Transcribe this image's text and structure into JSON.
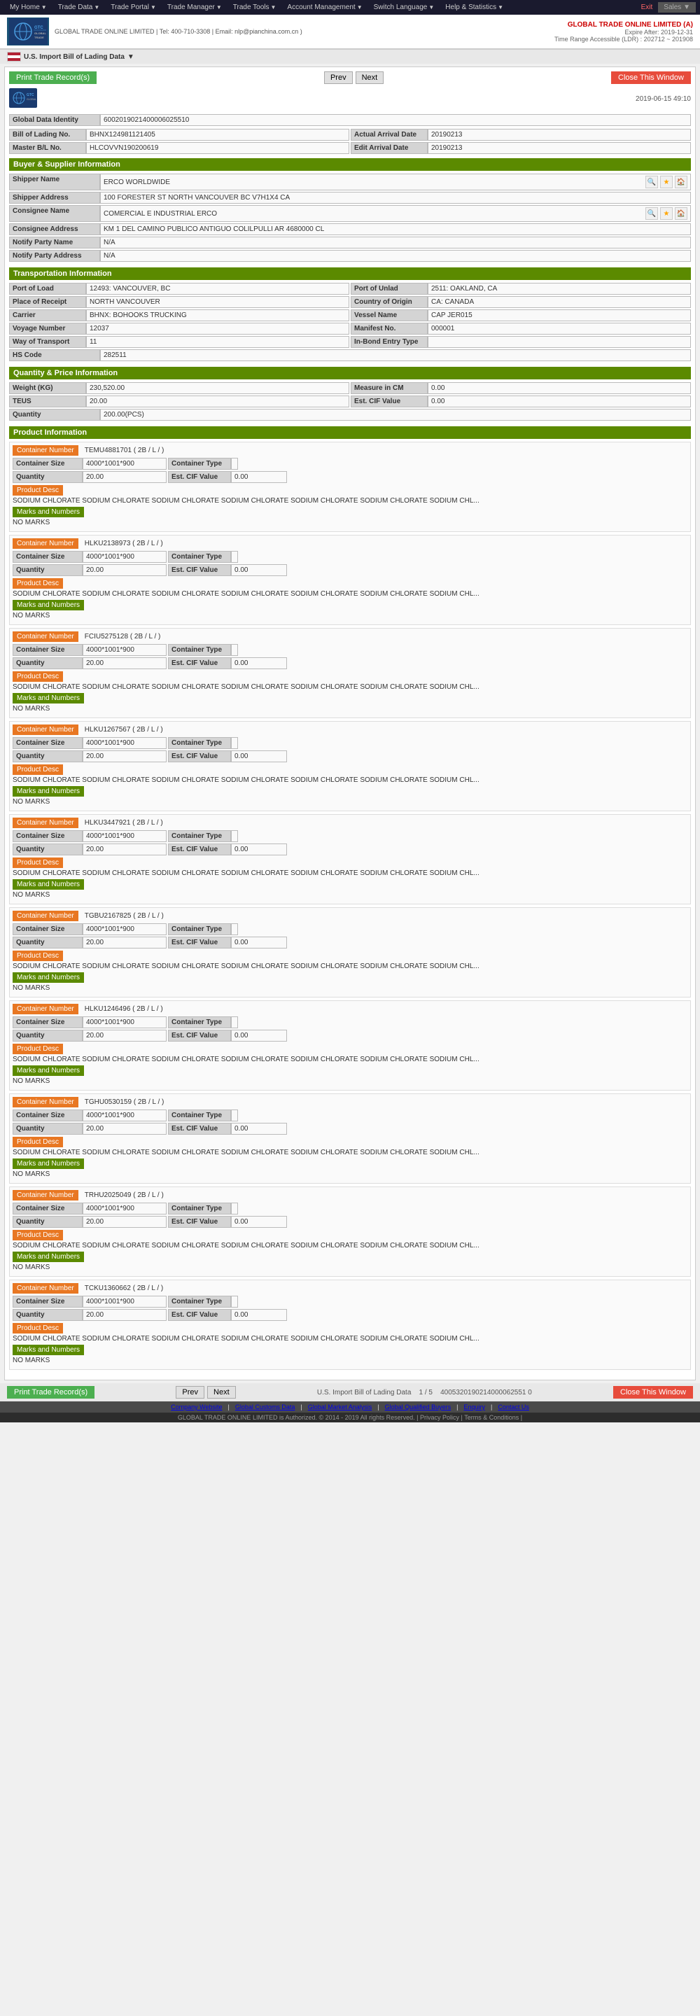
{
  "nav": {
    "items": [
      {
        "label": "My Home",
        "hasArrow": true
      },
      {
        "label": "Trade Data",
        "hasArrow": true
      },
      {
        "label": "Trade Portal",
        "hasArrow": true
      },
      {
        "label": "Trade Manager",
        "hasArrow": true
      },
      {
        "label": "Trade Tools",
        "hasArrow": true
      },
      {
        "label": "Account Management",
        "hasArrow": true
      },
      {
        "label": "Switch Language",
        "hasArrow": true
      },
      {
        "label": "Help & Statistics",
        "hasArrow": true
      },
      {
        "label": "Exit",
        "hasArrow": false
      }
    ],
    "sales_label": "Sales"
  },
  "header": {
    "company_name": "GLOBAL TRADE ONLINE LIMITED (A)",
    "expire": "Expire After: 2019-12-31",
    "time_range": "Time Range Accessible (LDR) : 202712 ~ 201908",
    "subtitle": "GLOBAL TRADE ONLINE LIMITED | Tel: 400-710-3308 | Email: nlp@pianchina.com.cn )"
  },
  "subheader": {
    "title": "U.S. Import Bill of Lading Data",
    "arrow": "▼"
  },
  "controls": {
    "print_btn": "Print Trade Record(s)",
    "prev_btn": "Prev",
    "next_btn": "Next",
    "close_btn": "Close This Window"
  },
  "record": {
    "datetime": "2019-06-15 49:10",
    "global_data_id": "6002019021400006025510",
    "bill_of_lading": "BHNX124981121405",
    "master_bl": "HLCOVVN190200619",
    "actual_arrival_date": "20190213",
    "edit_arrival_date": "20190213"
  },
  "buyer_supplier": {
    "section_title": "Buyer & Supplier Information",
    "shipper_label": "Shipper Name",
    "shipper_value": "ERCO WORLDWIDE",
    "shipper_addr_label": "Shipper Address",
    "shipper_addr_value": "100 FORESTER ST NORTH VANCOUVER BC V7H1X4 CA",
    "consignee_label": "Consignee Name",
    "consignee_value": "COMERCIAL E INDUSTRIAL ERCO",
    "consignee_addr_label": "Consignee Address",
    "consignee_addr_value": "KM 1 DEL CAMINO PUBLICO ANTIGUO COLILPULLI AR 4680000 CL",
    "notify_label": "Notify Party Name",
    "notify_value": "N/A",
    "notify_addr_label": "Notify Party Address",
    "notify_addr_value": "N/A"
  },
  "transportation": {
    "section_title": "Transportation Information",
    "port_of_load_label": "Port of Load",
    "port_of_load_value": "12493: VANCOUVER, BC",
    "port_of_unlad_label": "Port of Unlad",
    "port_of_unlad_value": "2511: OAKLAND, CA",
    "place_of_receipt_label": "Place of Receipt",
    "place_of_receipt_value": "NORTH VANCOUVER",
    "country_of_origin_label": "Country of Origin",
    "country_of_origin_value": "CA: CANADA",
    "carrier_label": "Carrier",
    "carrier_value": "BHNX: BOHOOKS TRUCKING",
    "vessel_name_label": "Vessel Name",
    "vessel_name_value": "CAP JER015",
    "voyage_number_label": "Voyage Number",
    "voyage_number_value": "12037",
    "manifest_no_label": "Manifest No.",
    "manifest_no_value": "000001",
    "way_of_transport_label": "Way of Transport",
    "way_of_transport_value": "11",
    "in_bond_entry_label": "In-Bond Entry Type",
    "in_bond_entry_value": "",
    "hs_code_label": "HS Code",
    "hs_code_value": "282511"
  },
  "quantity_price": {
    "section_title": "Quantity & Price Information",
    "weight_label": "Weight (KG)",
    "weight_value": "230,520.00",
    "measure_label": "Measure in CM",
    "measure_value": "0.00",
    "teus_label": "TEUS",
    "teus_value": "20.00",
    "cif_value_label": "Est. CIF Value",
    "cif_value": "0.00",
    "quantity_label": "Quantity",
    "quantity_value": "200.00(PCS)"
  },
  "product_section_title": "Product Information",
  "containers": [
    {
      "number": "TEMU4881701 ( 2B / L / )",
      "size": "4000*1001*900",
      "type": "",
      "quantity": "20.00",
      "cif": "0.00",
      "desc": "SODIUM CHLORATE SODIUM CHLORATE SODIUM CHLORATE SODIUM CHLORATE SODIUM CHLORATE SODIUM CHLORATE SODIUM CHL...",
      "marks": "NO MARKS"
    },
    {
      "number": "HLKU2138973 ( 2B / L / )",
      "size": "4000*1001*900",
      "type": "",
      "quantity": "20.00",
      "cif": "0.00",
      "desc": "SODIUM CHLORATE SODIUM CHLORATE SODIUM CHLORATE SODIUM CHLORATE SODIUM CHLORATE SODIUM CHLORATE SODIUM CHL...",
      "marks": "NO MARKS"
    },
    {
      "number": "FCIU5275128 ( 2B / L / )",
      "size": "4000*1001*900",
      "type": "",
      "quantity": "20.00",
      "cif": "0.00",
      "desc": "SODIUM CHLORATE SODIUM CHLORATE SODIUM CHLORATE SODIUM CHLORATE SODIUM CHLORATE SODIUM CHLORATE SODIUM CHL...",
      "marks": "NO MARKS"
    },
    {
      "number": "HLKU1267567 ( 2B / L / )",
      "size": "4000*1001*900",
      "type": "",
      "quantity": "20.00",
      "cif": "0.00",
      "desc": "SODIUM CHLORATE SODIUM CHLORATE SODIUM CHLORATE SODIUM CHLORATE SODIUM CHLORATE SODIUM CHLORATE SODIUM CHL...",
      "marks": "NO MARKS"
    },
    {
      "number": "HLKU3447921 ( 2B / L / )",
      "size": "4000*1001*900",
      "type": "",
      "quantity": "20.00",
      "cif": "0.00",
      "desc": "SODIUM CHLORATE SODIUM CHLORATE SODIUM CHLORATE SODIUM CHLORATE SODIUM CHLORATE SODIUM CHLORATE SODIUM CHL...",
      "marks": "NO MARKS"
    },
    {
      "number": "TGBU2167825 ( 2B / L / )",
      "size": "4000*1001*900",
      "type": "",
      "quantity": "20.00",
      "cif": "0.00",
      "desc": "SODIUM CHLORATE SODIUM CHLORATE SODIUM CHLORATE SODIUM CHLORATE SODIUM CHLORATE SODIUM CHLORATE SODIUM CHL...",
      "marks": "NO MARKS"
    },
    {
      "number": "HLKU1246496 ( 2B / L / )",
      "size": "4000*1001*900",
      "type": "",
      "quantity": "20.00",
      "cif": "0.00",
      "desc": "SODIUM CHLORATE SODIUM CHLORATE SODIUM CHLORATE SODIUM CHLORATE SODIUM CHLORATE SODIUM CHLORATE SODIUM CHL...",
      "marks": "NO MARKS"
    },
    {
      "number": "TGHU0530159 ( 2B / L / )",
      "size": "4000*1001*900",
      "type": "",
      "quantity": "20.00",
      "cif": "0.00",
      "desc": "SODIUM CHLORATE SODIUM CHLORATE SODIUM CHLORATE SODIUM CHLORATE SODIUM CHLORATE SODIUM CHLORATE SODIUM CHL...",
      "marks": "NO MARKS"
    },
    {
      "number": "TRHU2025049 ( 2B / L / )",
      "size": "4000*1001*900",
      "type": "",
      "quantity": "20.00",
      "cif": "0.00",
      "desc": "SODIUM CHLORATE SODIUM CHLORATE SODIUM CHLORATE SODIUM CHLORATE SODIUM CHLORATE SODIUM CHLORATE SODIUM CHL...",
      "marks": "NO MARKS"
    },
    {
      "number": "TCKU1360662 ( 2B / L / )",
      "size": "4000*1001*900",
      "type": "",
      "quantity": "20.00",
      "cif": "0.00",
      "desc": "SODIUM CHLORATE SODIUM CHLORATE SODIUM CHLORATE SODIUM CHLORATE SODIUM CHLORATE SODIUM CHLORATE SODIUM CHL...",
      "marks": "NO MARKS"
    }
  ],
  "bottom": {
    "page_title": "U.S. Import Bill of Lading Data",
    "page_info": "1 / 5",
    "record_id": "4005320190214000062551 0",
    "print_btn": "Print Trade Record(s)",
    "prev_btn": "Prev",
    "next_btn": "Next",
    "close_btn": "Close This Window"
  },
  "footer": {
    "links": [
      "Company Website",
      "Global Customs Data",
      "Global Market Analysis",
      "Global Qualified Buyers",
      "Enquiry",
      "Contact Us"
    ],
    "copyright": "GLOBAL TRADE ONLINE LIMITED is Authorized. © 2014 - 2019 All rights Reserved. | Privacy Policy | Terms & Conditions |"
  },
  "labels": {
    "global_data_id": "Global Data Identity",
    "bill_of_lading": "Bill of Lading No.",
    "master_bl": "Master B/L No.",
    "actual_arrival": "Actual Arrival Date",
    "edit_arrival": "Edit Arrival Date",
    "container_size": "Container Size",
    "container_type": "Container Type",
    "quantity": "Quantity",
    "est_cif": "Est. CIF Value",
    "product_desc": "Product Desc",
    "marks_numbers": "Marks and Numbers"
  }
}
